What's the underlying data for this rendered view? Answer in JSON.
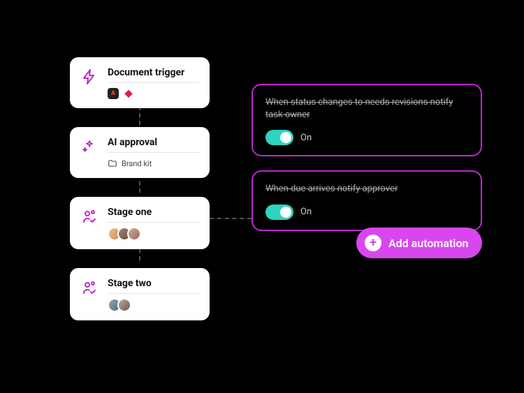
{
  "stages": [
    {
      "title": "Document trigger",
      "icon": "bolt",
      "meta_type": "apps",
      "apps": [
        "A",
        "ruby"
      ]
    },
    {
      "title": "AI approval",
      "icon": "sparkle",
      "meta_type": "folder",
      "folder_label": "Brand kit"
    },
    {
      "title": "Stage one",
      "icon": "person-check",
      "meta_type": "avatars",
      "avatar_count": 3
    },
    {
      "title": "Stage two",
      "icon": "person-check",
      "meta_type": "avatars",
      "avatar_count": 2
    }
  ],
  "automations": [
    {
      "description": "When status changes to needs revisions notify task owner",
      "state_label": "On",
      "enabled": true
    },
    {
      "description": "When due arrives notify approver",
      "state_label": "On",
      "enabled": true
    }
  ],
  "add_button_label": "Add automation",
  "colors": {
    "accent": "#c026d3",
    "accent_light": "#d946ef",
    "toggle_on": "#2dd4bf"
  }
}
